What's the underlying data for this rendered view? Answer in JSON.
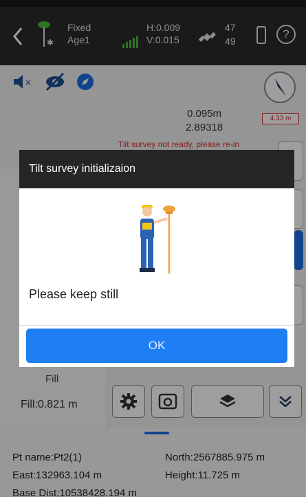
{
  "status_bar": {
    "fix_status": "Fixed",
    "age": "Age1",
    "h_precision": "H:0.009",
    "v_precision": "V:0.015",
    "sat_used": "47",
    "sat_visible": "49"
  },
  "survey": {
    "distance": "0.095m",
    "value2": "2.89318",
    "warning": "Tilt survey not ready, please re-in",
    "compass_dist": "4.33 m"
  },
  "left_panel": {
    "mode_label": "Fill",
    "fill_value": "Fill:0.821 m"
  },
  "point_info": {
    "pt_name": "Pt name:Pt2(1)",
    "north": "North:2567885.975 m",
    "east": "East:132963.104 m",
    "height": "Height:11.725 m",
    "base_dist": "Base Dist:10538428.194 m"
  },
  "dialog": {
    "title": "Tilt survey initializaion",
    "message": "Please keep still",
    "ok_label": "OK"
  },
  "colors": {
    "accent_blue": "#1f7ef4",
    "arrow_green": "#1b7a3e",
    "warning_red": "#d9302c",
    "signal_green": "#4cbc3a"
  },
  "icons": [
    "back-arrow-icon",
    "rover-antenna-icon",
    "bluetooth-icon",
    "signal-bars-icon",
    "satellite-icon",
    "battery-icon",
    "help-icon",
    "mute-icon",
    "hidden-eye-icon",
    "compass-nav-icon",
    "compass-icon",
    "down-arrow-icon",
    "settings-icon",
    "camera-icon",
    "layers-icon",
    "chevron-down-icon"
  ]
}
